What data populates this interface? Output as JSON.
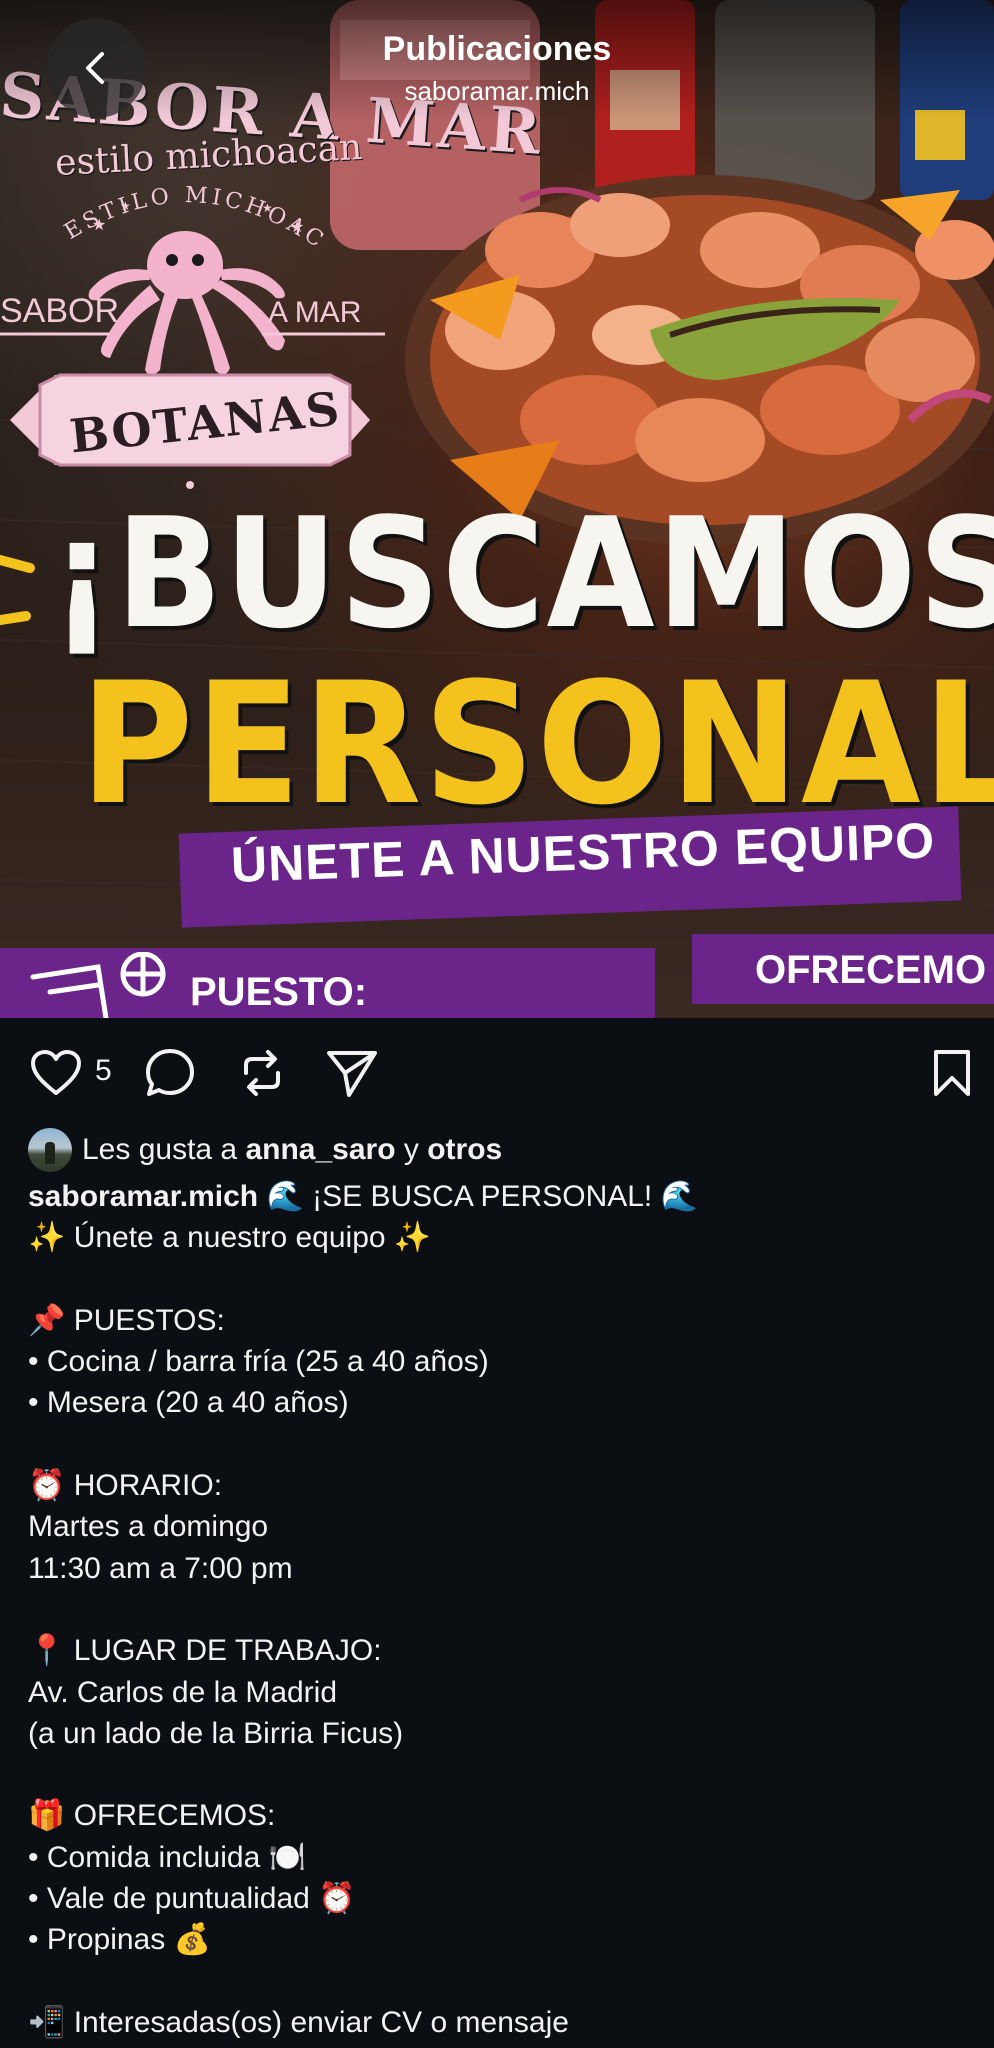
{
  "header": {
    "title": "Publicaciones",
    "subtitle": "saboramar.mich"
  },
  "post_image": {
    "brand_name": "SABOR A MAR",
    "brand_tagline": "estilo michoacán",
    "logo_arc_text": "ESTILO MICHOACÁN",
    "logo_left_text": "SABOR",
    "logo_right_text": "A MAR",
    "logo_banner_text": "BOTANAS",
    "headline_line1": "¡BUSCAMOS",
    "headline_line2": "PERSONAL",
    "ribbon_text": "ÚNETE A NUESTRO EQUIPO",
    "band_left_text": "PUESTO:",
    "band_right_text": "OFRECEMO",
    "colors": {
      "purple": "#6b2489",
      "yellow": "#f4c21c",
      "pink": "#f3c9d8"
    }
  },
  "actions": {
    "like_icon": "heart-icon",
    "like_count": "5",
    "comment_icon": "comment-icon",
    "repost_icon": "repost-icon",
    "share_icon": "send-icon",
    "save_icon": "bookmark-icon"
  },
  "likes": {
    "prefix": "Les gusta a",
    "user": "anna_saro",
    "conj": "y",
    "others": "otros"
  },
  "caption": {
    "username": "saboramar.mich",
    "first_line": "🌊 ¡SE BUSCA PERSONAL! 🌊",
    "lines": [
      "✨ Únete a nuestro equipo ✨",
      "",
      "📌 PUESTOS:",
      "• Cocina / barra fría (25 a 40 años)",
      "• Mesera (20 a 40 años)",
      "",
      "⏰ HORARIO:",
      "Martes a domingo",
      "11:30 am a 7:00 pm",
      "",
      "📍 LUGAR DE TRABAJO:",
      "Av. Carlos de la Madrid",
      "(a un lado de la Birria Ficus)",
      "",
      "🎁 OFRECEMOS:",
      "• Comida incluida 🍽️",
      "• Vale de puntualidad ⏰",
      "• Propinas 💰",
      "",
      "📲 Interesadas(os) enviar CV o mensaje"
    ]
  }
}
